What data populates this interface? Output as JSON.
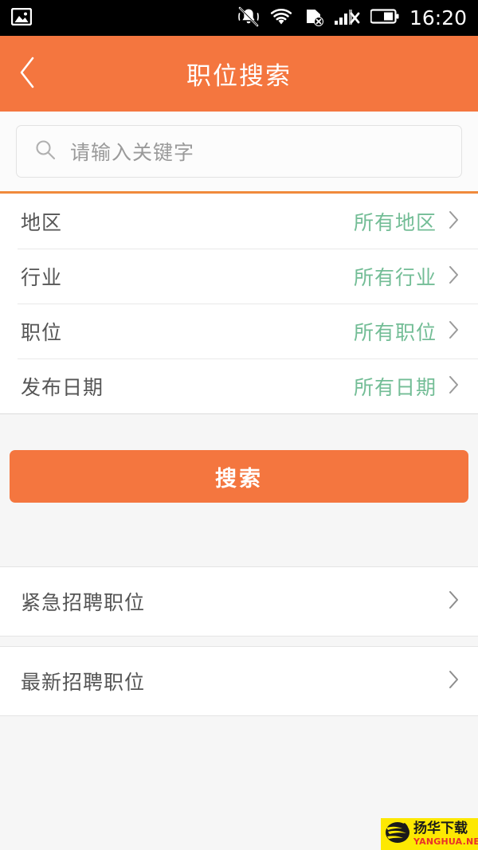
{
  "statusbar": {
    "photo_icon": "photo-icon",
    "icons": [
      {
        "name": "vibrate-mute-icon"
      },
      {
        "name": "wifi-icon"
      },
      {
        "name": "sim-card-off-icon"
      },
      {
        "name": "signal-off-icon"
      },
      {
        "name": "battery-icon"
      }
    ],
    "time": "16:20",
    "background": "#000000"
  },
  "header": {
    "title": "职位搜索",
    "back_icon": "back-chevron-icon",
    "background": "#f4763f",
    "text_color": "#ffffff"
  },
  "search": {
    "icon": "search-icon",
    "placeholder": "请输入关键字",
    "value": ""
  },
  "filters": [
    {
      "label": "地区",
      "value": "所有地区",
      "chevron": "chevron-right-icon"
    },
    {
      "label": "行业",
      "value": "所有行业",
      "chevron": "chevron-right-icon"
    },
    {
      "label": "职位",
      "value": "所有职位",
      "chevron": "chevron-right-icon"
    },
    {
      "label": "发布日期",
      "value": "所有日期",
      "chevron": "chevron-right-icon"
    }
  ],
  "filter_value_color": "#73bd96",
  "action": {
    "search_label": "搜索",
    "background": "#f4763f"
  },
  "links": [
    {
      "label": "紧急招聘职位",
      "chevron": "chevron-right-icon"
    },
    {
      "label": "最新招聘职位",
      "chevron": "chevron-right-icon"
    }
  ],
  "watermark": {
    "cn": "扬华下载",
    "en": "YANGHUA.NET",
    "background": "#fde802",
    "logo_icon": "globe-logo-icon"
  }
}
